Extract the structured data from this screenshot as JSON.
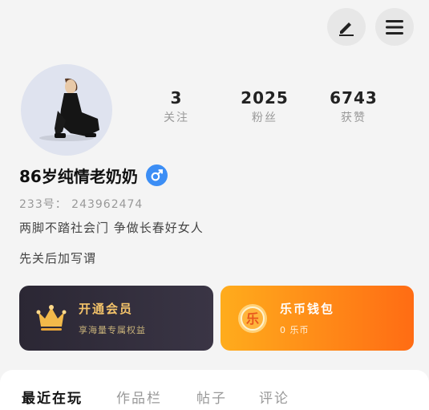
{
  "header": {
    "edit_icon": "pencil-icon",
    "menu_icon": "hamburger-menu-icon"
  },
  "profile": {
    "avatar": "user-avatar",
    "stats": [
      {
        "value": "3",
        "label": "关注"
      },
      {
        "value": "2025",
        "label": "粉丝"
      },
      {
        "value": "6743",
        "label": "获赞"
      }
    ],
    "nickname": "86岁纯情老奶奶",
    "gender_icon": "male-symbol-icon",
    "uid": "233号： 243962474",
    "signature": "两脚不踏社会门 争做长春好女人",
    "signature_line2": "先关后加写谓"
  },
  "cards": {
    "vip": {
      "title": "开通会员",
      "subtitle": "享海量专属权益",
      "icon": "crown-icon"
    },
    "wallet": {
      "title": "乐币钱包",
      "subtitle": "0 乐币",
      "icon": "le-coin-icon",
      "icon_text": "乐"
    }
  },
  "tabs": [
    {
      "label": "最近在玩",
      "active": true
    },
    {
      "label": "作品栏",
      "active": false
    },
    {
      "label": "帖子",
      "active": false
    },
    {
      "label": "评论",
      "active": false
    }
  ],
  "colors": {
    "gender_blue": "#3c8ef5",
    "vip_gold": "#f5c46a",
    "wallet_orange": "#ff8a18"
  }
}
